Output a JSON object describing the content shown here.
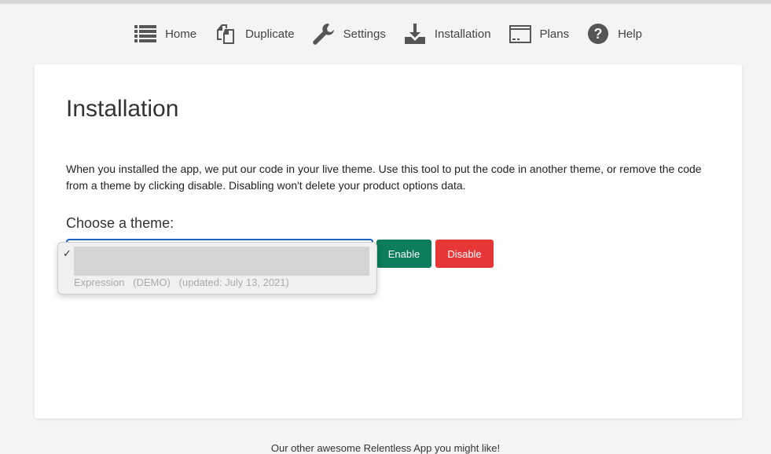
{
  "nav": [
    {
      "label": "Home",
      "icon": "list-icon"
    },
    {
      "label": "Duplicate",
      "icon": "duplicate-icon"
    },
    {
      "label": "Settings",
      "icon": "wrench-icon"
    },
    {
      "label": "Installation",
      "icon": "download-icon"
    },
    {
      "label": "Plans",
      "icon": "credit-card-icon"
    },
    {
      "label": "Help",
      "icon": "question-circle-icon"
    }
  ],
  "page": {
    "title": "Installation",
    "description": "When you installed the app, we put our code in your live theme. Use this tool to put the code in another theme, or remove the code from a theme by clicking disable. Disabling won't delete your product options data.",
    "choose_label": "Choose a theme:",
    "enable_label": "Enable",
    "disable_label": "Disable",
    "dropdown": {
      "check": "✓",
      "option": "Expression   (DEMO)   (updated: July 13, 2021)"
    }
  },
  "footer": "Our other awesome Relentless App you might like!",
  "colors": {
    "enable": "#0b7c5c",
    "disable": "#e73636",
    "focus": "#1d63c6"
  }
}
